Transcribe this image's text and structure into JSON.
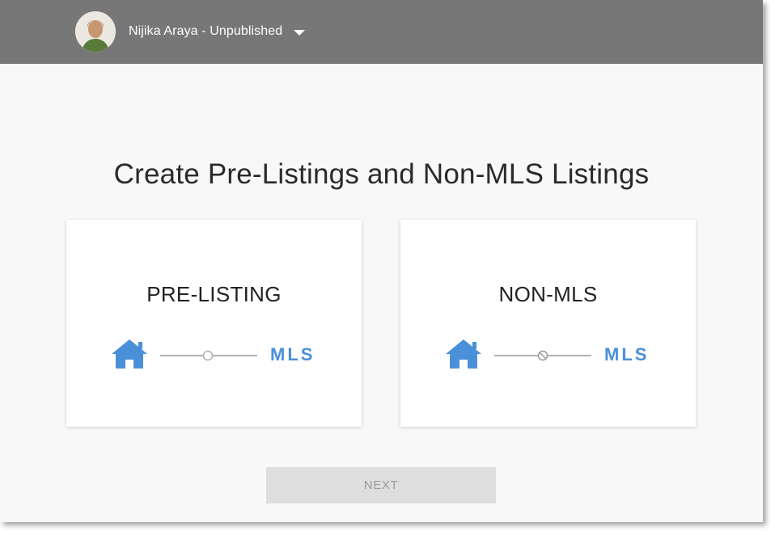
{
  "header": {
    "user_name": "Nijika Araya - Unpublished"
  },
  "main": {
    "title": "Create Pre-Listings and Non-MLS Listings",
    "cards": [
      {
        "title": "PRE-LISTING",
        "mls_label": "MLS",
        "connector_icon": "circle-icon"
      },
      {
        "title": "NON-MLS",
        "mls_label": "MLS",
        "connector_icon": "prohibited-icon"
      }
    ],
    "next_label": "NEXT"
  },
  "colors": {
    "topbar": "#777777",
    "accent_blue": "#4a90d9",
    "connector_gray": "#b0b0b0",
    "button_disabled_bg": "#dedede",
    "button_disabled_text": "#9a9a9a"
  }
}
